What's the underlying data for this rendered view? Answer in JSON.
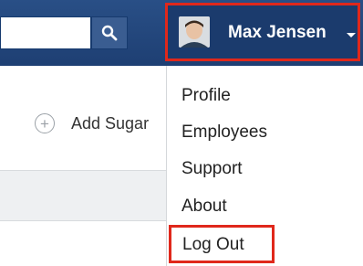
{
  "user": {
    "name": "Max Jensen"
  },
  "actions": {
    "add_label": "Add Sugar"
  },
  "user_menu": {
    "items": [
      "Profile",
      "Employees",
      "Support",
      "About",
      "Log Out"
    ]
  },
  "icons": [
    "search-icon",
    "avatar",
    "chevron-down-icon",
    "plus-circle-icon"
  ]
}
